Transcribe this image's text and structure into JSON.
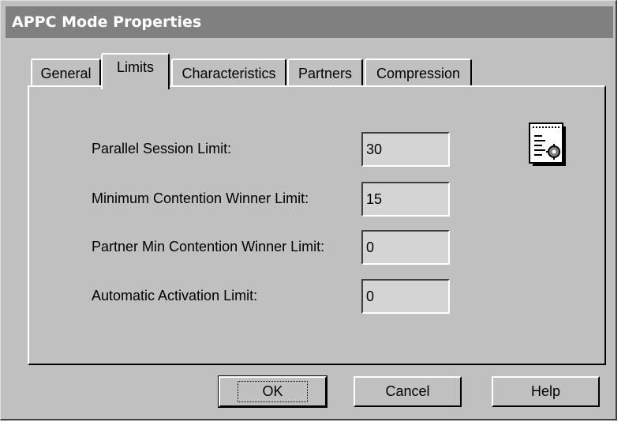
{
  "window": {
    "title": "APPC Mode Properties"
  },
  "tabs": [
    {
      "label": "General",
      "active": false
    },
    {
      "label": "Limits",
      "active": true
    },
    {
      "label": "Characteristics",
      "active": false
    },
    {
      "label": "Partners",
      "active": false
    },
    {
      "label": "Compression",
      "active": false
    }
  ],
  "limits": {
    "fields": [
      {
        "label": "Parallel Session Limit:",
        "value": "30"
      },
      {
        "label": "Minimum Contention Winner Limit:",
        "value": "15"
      },
      {
        "label": "Partner Min Contention Winner Limit:",
        "value": "0"
      },
      {
        "label": "Automatic Activation Limit:",
        "value": "0"
      }
    ],
    "icon": "properties-document-icon"
  },
  "buttons": {
    "ok": "OK",
    "cancel": "Cancel",
    "help": "Help"
  },
  "colors": {
    "face": "#c0c0c0",
    "titlebar": "#808080",
    "field": "#d4d4d4"
  }
}
